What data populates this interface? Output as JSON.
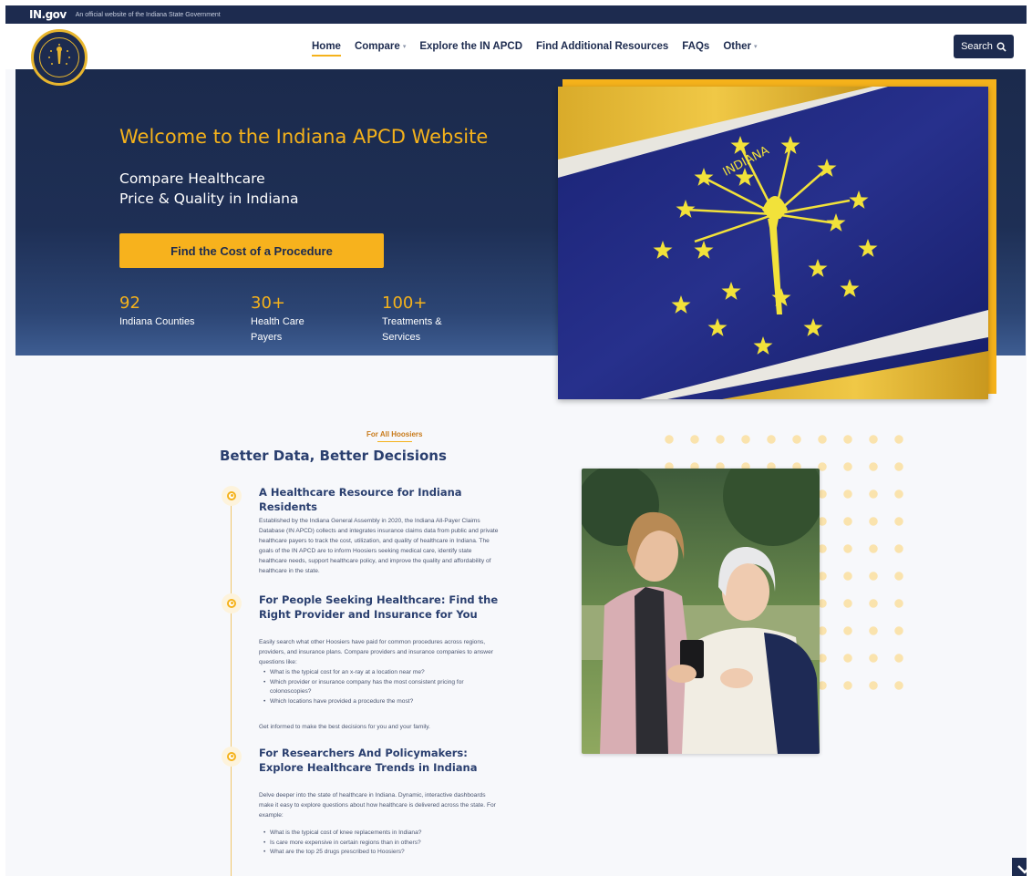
{
  "govbar": {
    "logo": "IN.gov",
    "text": "An official website of the Indiana State Government"
  },
  "nav": {
    "items": [
      {
        "label": "Home",
        "active": true
      },
      {
        "label": "Compare",
        "dropdown": true
      },
      {
        "label": "Explore the IN APCD"
      },
      {
        "label": "Find Additional Resources"
      },
      {
        "label": "FAQs"
      },
      {
        "label": "Other",
        "dropdown": true
      }
    ],
    "search_label": "Search"
  },
  "hero": {
    "title": "Welcome to the Indiana APCD Website",
    "subtitle_line1": "Compare Healthcare",
    "subtitle_line2": "Price & Quality in Indiana",
    "cta": "Find the Cost of a Procedure",
    "stats": [
      {
        "value": "92",
        "label": "Indiana Counties"
      },
      {
        "value": "30+",
        "label": "Health Care Payers"
      },
      {
        "value": "100+",
        "label": "Treatments & Services"
      }
    ],
    "flag_text": "INDIANA"
  },
  "section": {
    "kicker": "For All Hoosiers",
    "title": "Better Data, Better Decisions",
    "items": [
      {
        "title": "A Healthcare Resource for Indiana Residents",
        "body": "Established by the Indiana General Assembly in 2020, the Indiana All-Payer Claims Database (IN APCD) collects and integrates insurance claims data from public and private healthcare payers to track the cost, utilization, and quality of healthcare in Indiana. The goals of the IN APCD are to inform Hoosiers seeking medical care, identify state healthcare needs, support healthcare policy, and improve the quality and affordability of healthcare in the state."
      },
      {
        "title": "For People Seeking Healthcare: Find the Right Provider and Insurance for You",
        "body": "Easily search what other Hoosiers have paid for common procedures across regions, providers, and insurance plans. Compare providers and insurance companies to answer questions like:",
        "bullets": [
          "What is the typical cost for an x-ray at a location near me?",
          "Which provider or insurance company has the most consistent pricing for colonoscopies?",
          "Which locations have provided a procedure the most?"
        ],
        "footer": "Get informed to make the best decisions for you and your family."
      },
      {
        "title": "For Researchers And Policymakers: Explore Healthcare Trends in Indiana",
        "body": "Delve deeper into the state of healthcare in Indiana. Dynamic, interactive dashboards make it easy to explore questions about how healthcare is delivered across the state. For example:",
        "bullets": [
          "What is the typical cost of knee replacements in Indiana?",
          "Is care more expensive in certain regions than in others?",
          "What are the top 25 drugs prescribed to Hoosiers?"
        ]
      }
    ]
  },
  "colors": {
    "navy": "#1d2b4f",
    "gold": "#f5b21b",
    "flag_blue": "#1c2478"
  }
}
